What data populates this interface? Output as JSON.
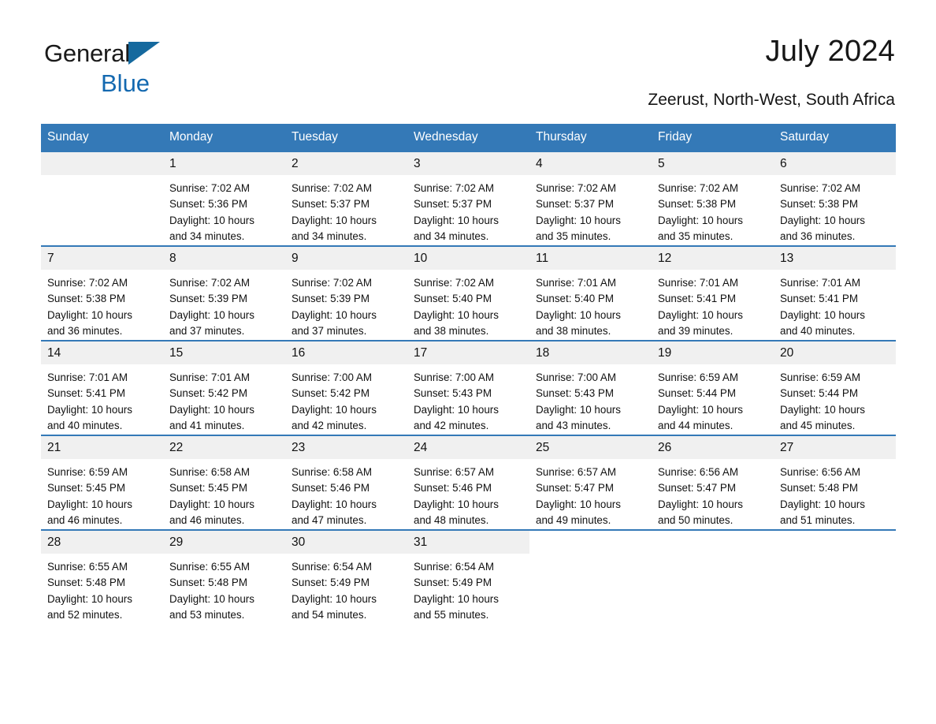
{
  "brand": {
    "name_part1": "General",
    "name_part2": "Blue",
    "triangle_color": "#15699e",
    "blue_text_color": "#1469b0"
  },
  "header": {
    "title": "July 2024",
    "location": "Zeerust, North-West, South Africa"
  },
  "theme": {
    "header_bg": "#3479b7",
    "header_text": "#ffffff",
    "daynum_bg": "#f0f0f0",
    "cell_bg": "#ffffff",
    "row_separator": "#3479b7"
  },
  "calendar": {
    "weekday_headers": [
      "Sunday",
      "Monday",
      "Tuesday",
      "Wednesday",
      "Thursday",
      "Friday",
      "Saturday"
    ],
    "weeks": [
      [
        {
          "day": "",
          "sunrise": "",
          "sunset": "",
          "daylight_line1": "",
          "daylight_line2": "",
          "empty": true
        },
        {
          "day": "1",
          "sunrise": "Sunrise: 7:02 AM",
          "sunset": "Sunset: 5:36 PM",
          "daylight_line1": "Daylight: 10 hours",
          "daylight_line2": "and 34 minutes."
        },
        {
          "day": "2",
          "sunrise": "Sunrise: 7:02 AM",
          "sunset": "Sunset: 5:37 PM",
          "daylight_line1": "Daylight: 10 hours",
          "daylight_line2": "and 34 minutes."
        },
        {
          "day": "3",
          "sunrise": "Sunrise: 7:02 AM",
          "sunset": "Sunset: 5:37 PM",
          "daylight_line1": "Daylight: 10 hours",
          "daylight_line2": "and 34 minutes."
        },
        {
          "day": "4",
          "sunrise": "Sunrise: 7:02 AM",
          "sunset": "Sunset: 5:37 PM",
          "daylight_line1": "Daylight: 10 hours",
          "daylight_line2": "and 35 minutes."
        },
        {
          "day": "5",
          "sunrise": "Sunrise: 7:02 AM",
          "sunset": "Sunset: 5:38 PM",
          "daylight_line1": "Daylight: 10 hours",
          "daylight_line2": "and 35 minutes."
        },
        {
          "day": "6",
          "sunrise": "Sunrise: 7:02 AM",
          "sunset": "Sunset: 5:38 PM",
          "daylight_line1": "Daylight: 10 hours",
          "daylight_line2": "and 36 minutes."
        }
      ],
      [
        {
          "day": "7",
          "sunrise": "Sunrise: 7:02 AM",
          "sunset": "Sunset: 5:38 PM",
          "daylight_line1": "Daylight: 10 hours",
          "daylight_line2": "and 36 minutes."
        },
        {
          "day": "8",
          "sunrise": "Sunrise: 7:02 AM",
          "sunset": "Sunset: 5:39 PM",
          "daylight_line1": "Daylight: 10 hours",
          "daylight_line2": "and 37 minutes."
        },
        {
          "day": "9",
          "sunrise": "Sunrise: 7:02 AM",
          "sunset": "Sunset: 5:39 PM",
          "daylight_line1": "Daylight: 10 hours",
          "daylight_line2": "and 37 minutes."
        },
        {
          "day": "10",
          "sunrise": "Sunrise: 7:02 AM",
          "sunset": "Sunset: 5:40 PM",
          "daylight_line1": "Daylight: 10 hours",
          "daylight_line2": "and 38 minutes."
        },
        {
          "day": "11",
          "sunrise": "Sunrise: 7:01 AM",
          "sunset": "Sunset: 5:40 PM",
          "daylight_line1": "Daylight: 10 hours",
          "daylight_line2": "and 38 minutes."
        },
        {
          "day": "12",
          "sunrise": "Sunrise: 7:01 AM",
          "sunset": "Sunset: 5:41 PM",
          "daylight_line1": "Daylight: 10 hours",
          "daylight_line2": "and 39 minutes."
        },
        {
          "day": "13",
          "sunrise": "Sunrise: 7:01 AM",
          "sunset": "Sunset: 5:41 PM",
          "daylight_line1": "Daylight: 10 hours",
          "daylight_line2": "and 40 minutes."
        }
      ],
      [
        {
          "day": "14",
          "sunrise": "Sunrise: 7:01 AM",
          "sunset": "Sunset: 5:41 PM",
          "daylight_line1": "Daylight: 10 hours",
          "daylight_line2": "and 40 minutes."
        },
        {
          "day": "15",
          "sunrise": "Sunrise: 7:01 AM",
          "sunset": "Sunset: 5:42 PM",
          "daylight_line1": "Daylight: 10 hours",
          "daylight_line2": "and 41 minutes."
        },
        {
          "day": "16",
          "sunrise": "Sunrise: 7:00 AM",
          "sunset": "Sunset: 5:42 PM",
          "daylight_line1": "Daylight: 10 hours",
          "daylight_line2": "and 42 minutes."
        },
        {
          "day": "17",
          "sunrise": "Sunrise: 7:00 AM",
          "sunset": "Sunset: 5:43 PM",
          "daylight_line1": "Daylight: 10 hours",
          "daylight_line2": "and 42 minutes."
        },
        {
          "day": "18",
          "sunrise": "Sunrise: 7:00 AM",
          "sunset": "Sunset: 5:43 PM",
          "daylight_line1": "Daylight: 10 hours",
          "daylight_line2": "and 43 minutes."
        },
        {
          "day": "19",
          "sunrise": "Sunrise: 6:59 AM",
          "sunset": "Sunset: 5:44 PM",
          "daylight_line1": "Daylight: 10 hours",
          "daylight_line2": "and 44 minutes."
        },
        {
          "day": "20",
          "sunrise": "Sunrise: 6:59 AM",
          "sunset": "Sunset: 5:44 PM",
          "daylight_line1": "Daylight: 10 hours",
          "daylight_line2": "and 45 minutes."
        }
      ],
      [
        {
          "day": "21",
          "sunrise": "Sunrise: 6:59 AM",
          "sunset": "Sunset: 5:45 PM",
          "daylight_line1": "Daylight: 10 hours",
          "daylight_line2": "and 46 minutes."
        },
        {
          "day": "22",
          "sunrise": "Sunrise: 6:58 AM",
          "sunset": "Sunset: 5:45 PM",
          "daylight_line1": "Daylight: 10 hours",
          "daylight_line2": "and 46 minutes."
        },
        {
          "day": "23",
          "sunrise": "Sunrise: 6:58 AM",
          "sunset": "Sunset: 5:46 PM",
          "daylight_line1": "Daylight: 10 hours",
          "daylight_line2": "and 47 minutes."
        },
        {
          "day": "24",
          "sunrise": "Sunrise: 6:57 AM",
          "sunset": "Sunset: 5:46 PM",
          "daylight_line1": "Daylight: 10 hours",
          "daylight_line2": "and 48 minutes."
        },
        {
          "day": "25",
          "sunrise": "Sunrise: 6:57 AM",
          "sunset": "Sunset: 5:47 PM",
          "daylight_line1": "Daylight: 10 hours",
          "daylight_line2": "and 49 minutes."
        },
        {
          "day": "26",
          "sunrise": "Sunrise: 6:56 AM",
          "sunset": "Sunset: 5:47 PM",
          "daylight_line1": "Daylight: 10 hours",
          "daylight_line2": "and 50 minutes."
        },
        {
          "day": "27",
          "sunrise": "Sunrise: 6:56 AM",
          "sunset": "Sunset: 5:48 PM",
          "daylight_line1": "Daylight: 10 hours",
          "daylight_line2": "and 51 minutes."
        }
      ],
      [
        {
          "day": "28",
          "sunrise": "Sunrise: 6:55 AM",
          "sunset": "Sunset: 5:48 PM",
          "daylight_line1": "Daylight: 10 hours",
          "daylight_line2": "and 52 minutes."
        },
        {
          "day": "29",
          "sunrise": "Sunrise: 6:55 AM",
          "sunset": "Sunset: 5:48 PM",
          "daylight_line1": "Daylight: 10 hours",
          "daylight_line2": "and 53 minutes."
        },
        {
          "day": "30",
          "sunrise": "Sunrise: 6:54 AM",
          "sunset": "Sunset: 5:49 PM",
          "daylight_line1": "Daylight: 10 hours",
          "daylight_line2": "and 54 minutes."
        },
        {
          "day": "31",
          "sunrise": "Sunrise: 6:54 AM",
          "sunset": "Sunset: 5:49 PM",
          "daylight_line1": "Daylight: 10 hours",
          "daylight_line2": "and 55 minutes."
        },
        {
          "day": "",
          "sunrise": "",
          "sunset": "",
          "daylight_line1": "",
          "daylight_line2": "",
          "empty": true,
          "void": true
        },
        {
          "day": "",
          "sunrise": "",
          "sunset": "",
          "daylight_line1": "",
          "daylight_line2": "",
          "empty": true,
          "void": true
        },
        {
          "day": "",
          "sunrise": "",
          "sunset": "",
          "daylight_line1": "",
          "daylight_line2": "",
          "empty": true,
          "void": true
        }
      ]
    ]
  }
}
